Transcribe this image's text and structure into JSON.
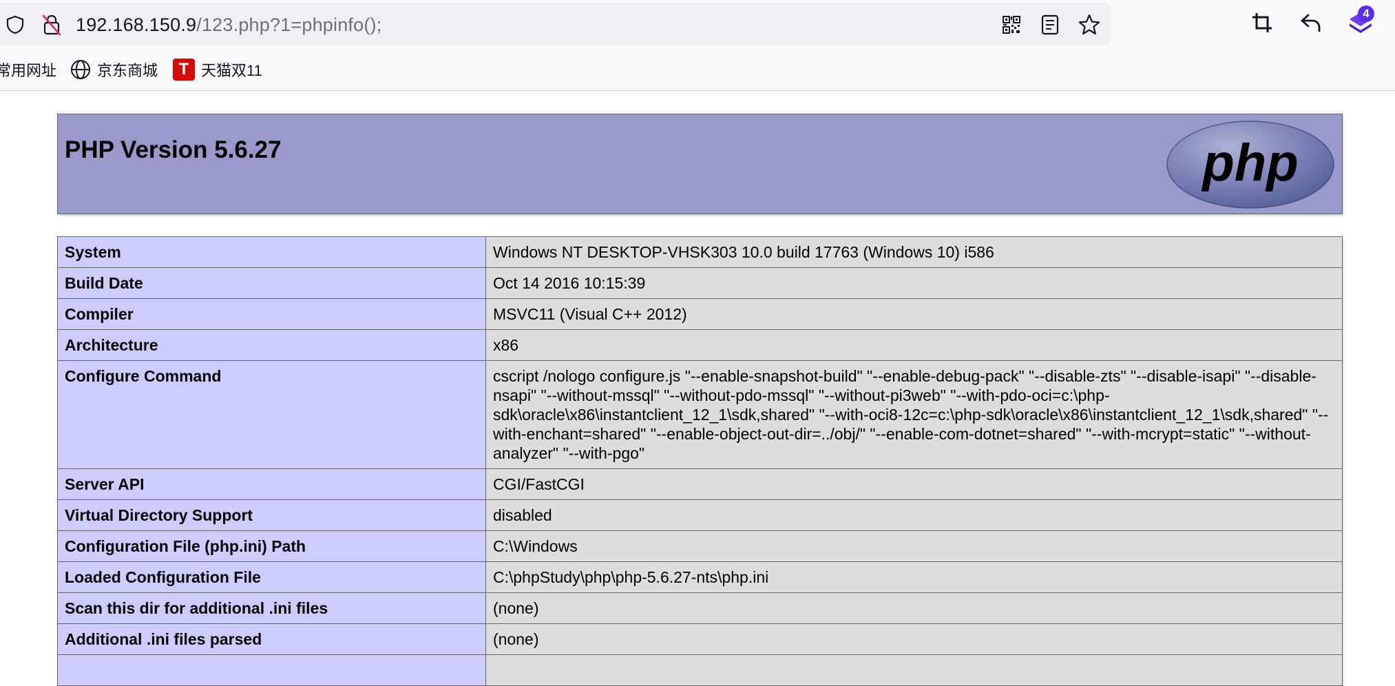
{
  "browser": {
    "url_host": "192.168.150.9",
    "url_path": "/123.php?1=phpinfo();",
    "extension_badge": "4",
    "bookmarks": [
      {
        "label": "常用网址",
        "icon": "none"
      },
      {
        "label": "京东商城",
        "icon": "globe-icon"
      },
      {
        "label": "天猫双11",
        "icon": "tmall-icon",
        "icon_text": "T"
      }
    ]
  },
  "colors": {
    "header_bg": "#9999cc",
    "key_cell_bg": "#ccccff",
    "value_cell_bg": "#dddddd",
    "border": "#666666"
  },
  "page": {
    "title": "PHP Version 5.6.27",
    "logo_text": "php"
  },
  "info_rows": [
    {
      "key": "System",
      "value": "Windows NT DESKTOP-VHSK303 10.0 build 17763 (Windows 10) i586"
    },
    {
      "key": "Build Date",
      "value": "Oct 14 2016 10:15:39"
    },
    {
      "key": "Compiler",
      "value": "MSVC11 (Visual C++ 2012)"
    },
    {
      "key": "Architecture",
      "value": "x86"
    },
    {
      "key": "Configure Command",
      "value": "cscript /nologo configure.js \"--enable-snapshot-build\" \"--enable-debug-pack\" \"--disable-zts\" \"--disable-isapi\" \"--disable-nsapi\" \"--without-mssql\" \"--without-pdo-mssql\" \"--without-pi3web\" \"--with-pdo-oci=c:\\php-sdk\\oracle\\x86\\instantclient_12_1\\sdk,shared\" \"--with-oci8-12c=c:\\php-sdk\\oracle\\x86\\instantclient_12_1\\sdk,shared\" \"--with-enchant=shared\" \"--enable-object-out-dir=../obj/\" \"--enable-com-dotnet=shared\" \"--with-mcrypt=static\" \"--without-analyzer\" \"--with-pgo\""
    },
    {
      "key": "Server API",
      "value": "CGI/FastCGI"
    },
    {
      "key": "Virtual Directory Support",
      "value": "disabled"
    },
    {
      "key": "Configuration File (php.ini) Path",
      "value": "C:\\Windows"
    },
    {
      "key": "Loaded Configuration File",
      "value": "C:\\phpStudy\\php\\php-5.6.27-nts\\php.ini"
    },
    {
      "key": "Scan this dir for additional .ini files",
      "value": "(none)"
    },
    {
      "key": "Additional .ini files parsed",
      "value": "(none)"
    },
    {
      "key": "",
      "value": ""
    }
  ]
}
